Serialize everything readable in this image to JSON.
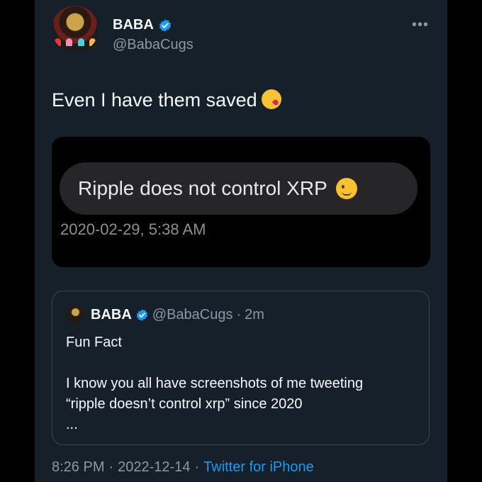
{
  "author": {
    "name": "BABA",
    "handle": "@BabaCugs",
    "verified": true
  },
  "more_icon": "•••",
  "tweet_text": "Even I have them saved",
  "tweet_emoji": "kissing-heart-emoji",
  "media": {
    "message_text": "Ripple does not control XRP",
    "message_emoji": "winking-face-emoji",
    "timestamp": "2020-02-29, 5:38 AM"
  },
  "quoted_tweet": {
    "name": "BABA",
    "handle": "@BabaCugs",
    "separator": "·",
    "time_ago": "2m",
    "text": "Fun Fact\n\nI know you all have screenshots of me tweeting\n“ripple doesn’t control xrp” since 2020\n..."
  },
  "footer": {
    "time": "8:26 PM",
    "separator": "·",
    "date": "2022-12-14",
    "separator2": "·",
    "source": "Twitter for iPhone"
  },
  "colors": {
    "background": "#15202b",
    "accent": "#1d9bf0",
    "secondary_text": "#8b98a5"
  }
}
